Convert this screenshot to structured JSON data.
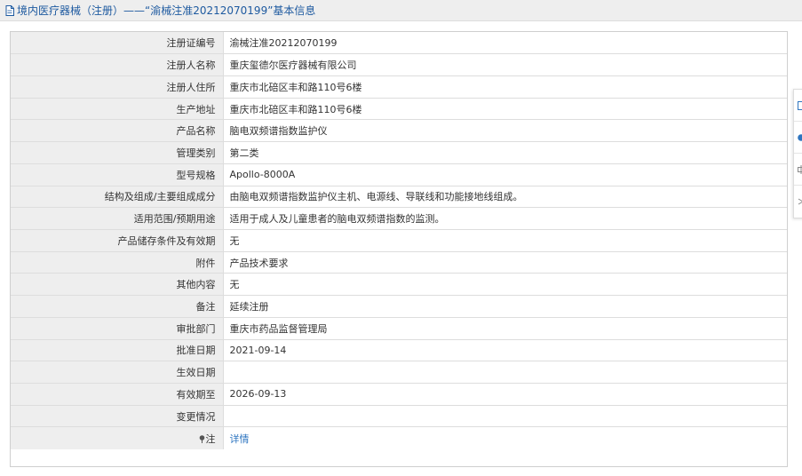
{
  "header": {
    "title": "境内医疗器械（注册）——“渝械注准20212070199”基本信息"
  },
  "rows": [
    {
      "label": "注册证编号",
      "value": "渝械注准20212070199"
    },
    {
      "label": "注册人名称",
      "value": "重庆玺德尔医疗器械有限公司"
    },
    {
      "label": "注册人住所",
      "value": "重庆市北碚区丰和路110号6楼"
    },
    {
      "label": "生产地址",
      "value": "重庆市北碚区丰和路110号6楼"
    },
    {
      "label": "产品名称",
      "value": "脑电双频谱指数监护仪"
    },
    {
      "label": "管理类别",
      "value": "第二类"
    },
    {
      "label": "型号规格",
      "value": "Apollo-8000A"
    },
    {
      "label": "结构及组成/主要组成成分",
      "value": "由脑电双频谱指数监护仪主机、电源线、导联线和功能接地线组成。"
    },
    {
      "label": "适用范围/预期用途",
      "value": "适用于成人及儿童患者的脑电双频谱指数的监测。"
    },
    {
      "label": "产品储存条件及有效期",
      "value": "无"
    },
    {
      "label": "附件",
      "value": "产品技术要求"
    },
    {
      "label": "其他内容",
      "value": "无"
    },
    {
      "label": "备注",
      "value": "延续注册"
    },
    {
      "label": "审批部门",
      "value": "重庆市药品监督管理局"
    },
    {
      "label": "批准日期",
      "value": "2021-09-14"
    },
    {
      "label": "生效日期",
      "value": ""
    },
    {
      "label": "有效期至",
      "value": "2026-09-13"
    },
    {
      "label": "变更情况",
      "value": ""
    }
  ],
  "note_row": {
    "label": "注",
    "link": "详情"
  },
  "colors": {
    "header_text": "#1e5aa0",
    "label_bg": "#eeeeee",
    "link": "#2e75c0",
    "side_icon": "#2e75c0"
  },
  "icons": {
    "header": "document-icon",
    "note": "pin-icon",
    "side": [
      "square-icon",
      "circle-icon",
      "tag-icon",
      "arrow-icon"
    ]
  }
}
